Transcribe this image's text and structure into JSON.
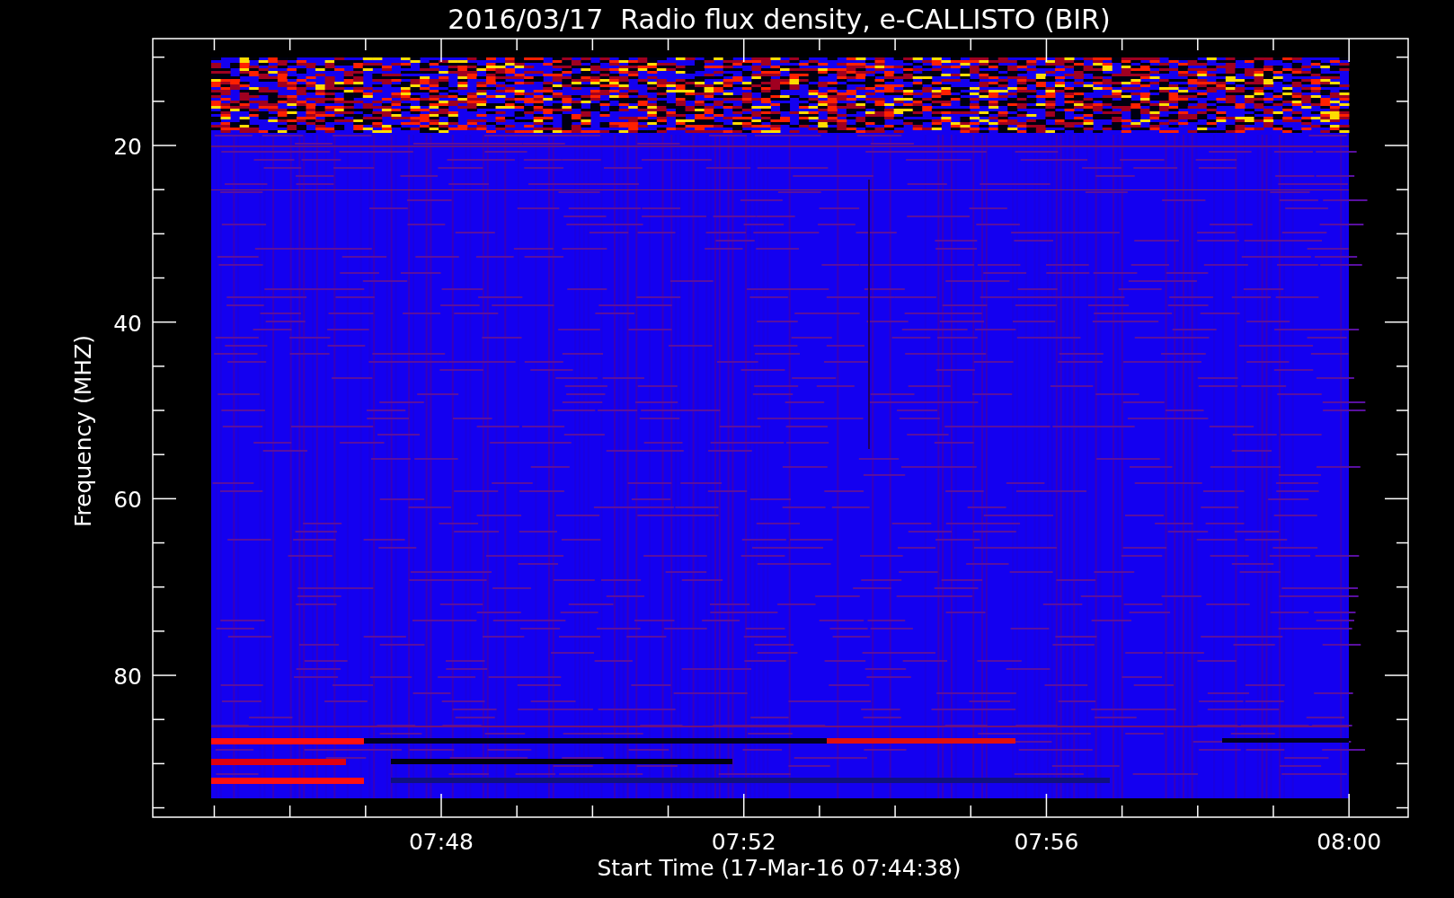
{
  "title": "2016/03/17  Radio flux density, e-CALLISTO (BIR)",
  "y_axis": {
    "label": "Frequency (MHZ)",
    "tick_labels": [
      "20",
      "40",
      "60",
      "80"
    ]
  },
  "x_axis": {
    "label": "Start Time (17-Mar-16 07:44:38)",
    "tick_labels": [
      "07:48",
      "07:52",
      "07:56",
      "08:00"
    ]
  }
}
